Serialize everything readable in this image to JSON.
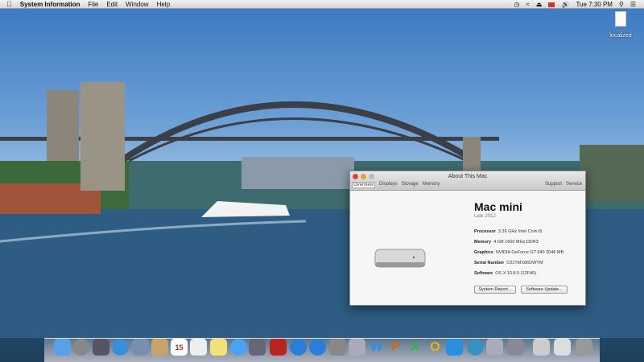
{
  "menubar": {
    "app_name": "System Information",
    "items": [
      "File",
      "Edit",
      "Window",
      "Help"
    ],
    "clock": "Tue 7:30 PM"
  },
  "desktop": {
    "icon_label": "localized"
  },
  "window": {
    "title": "About This Mac",
    "tabs": [
      "Overview",
      "Displays",
      "Storage",
      "Memory"
    ],
    "tabs_right": [
      "Support",
      "Service"
    ],
    "model": "Mac mini",
    "year": "Late 2012",
    "specs": [
      {
        "label": "Processor",
        "value": "3.39 GHz Intel Core i5"
      },
      {
        "label": "Memory",
        "value": "4 GB 1600 MHz DDR3"
      },
      {
        "label": "Graphics",
        "value": "NVIDIA GeForce GT 640 2048 MB"
      },
      {
        "label": "Serial Number",
        "value": "C02TMX86DWYM"
      },
      {
        "label": "Software",
        "value": "OS X 10.8.5 (12F45)"
      }
    ],
    "buttons": {
      "system_report": "System Report...",
      "software_update": "Software Update..."
    }
  },
  "dock": {
    "icons": [
      "finder",
      "launchpad",
      "dashboard",
      "safari",
      "preview",
      "contacts",
      "calendar",
      "reminders",
      "notes",
      "messages",
      "facetime",
      "photo-booth",
      "itunes",
      "app-store",
      "system-preferences",
      "remote-desktop",
      "word",
      "powerpoint",
      "excel",
      "outlook",
      "lync",
      "network",
      "remote-desktop-2",
      "keychain",
      "utilities",
      "mail",
      "trash"
    ],
    "calendar_day": "15",
    "word": "W",
    "powerpoint": "P",
    "excel": "X",
    "outlook": "O"
  }
}
